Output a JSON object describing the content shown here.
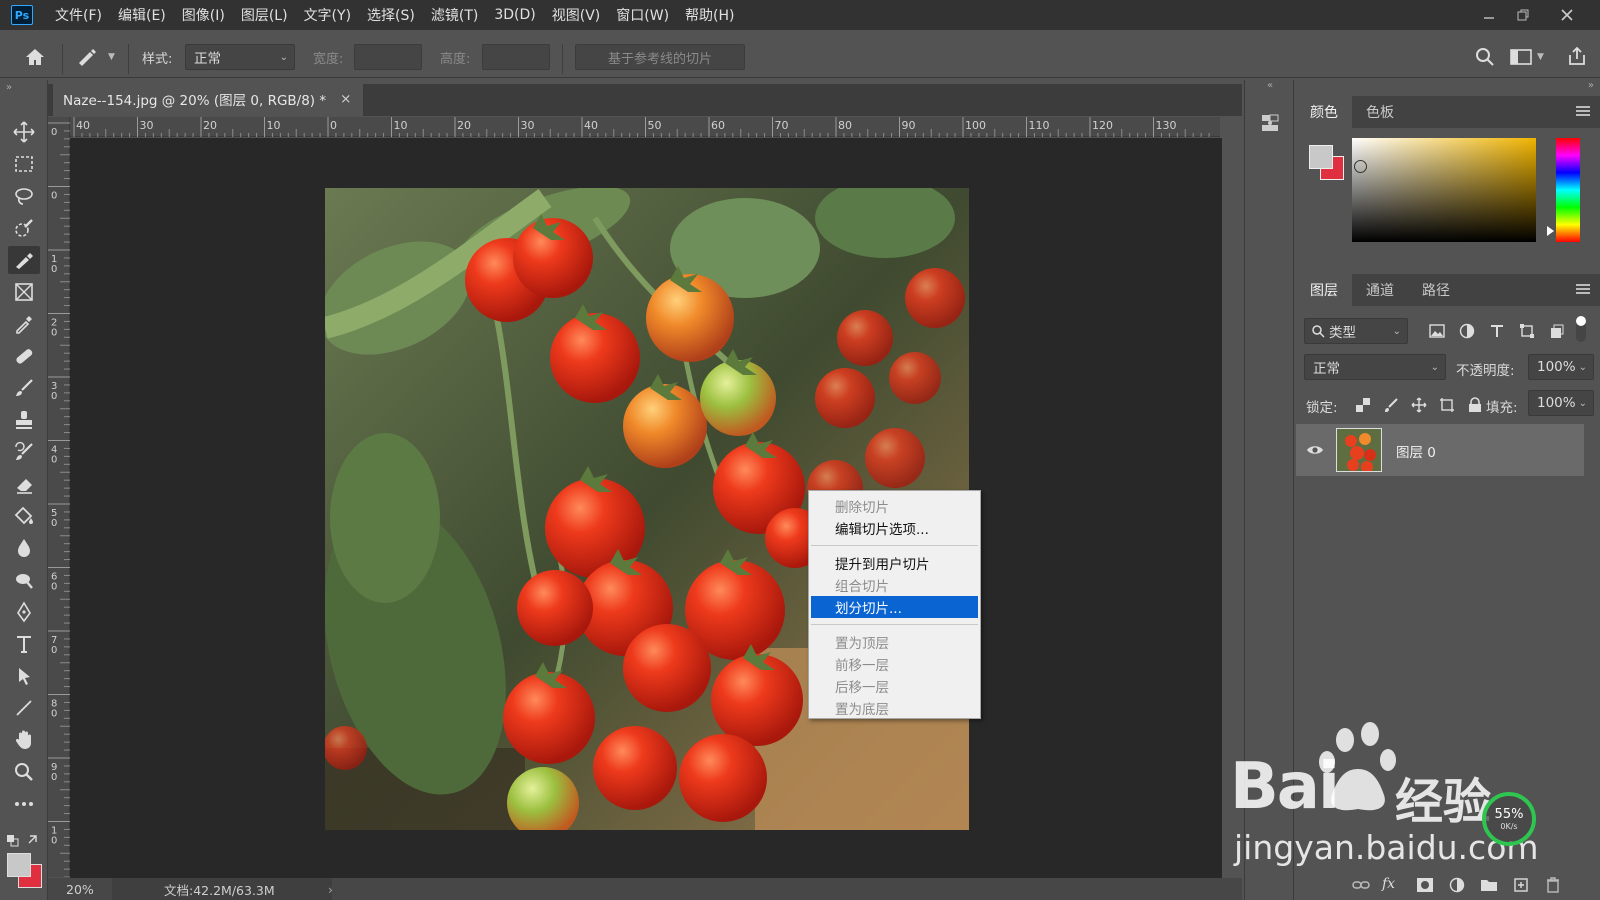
{
  "menubar": {
    "logo": "Ps",
    "items": [
      "文件(F)",
      "编辑(E)",
      "图像(I)",
      "图层(L)",
      "文字(Y)",
      "选择(S)",
      "滤镜(T)",
      "3D(D)",
      "视图(V)",
      "窗口(W)",
      "帮助(H)"
    ]
  },
  "options": {
    "style_label": "样式:",
    "style_value": "正常",
    "width_label": "宽度:",
    "height_label": "高度:",
    "guides_button": "基于参考线的切片"
  },
  "document": {
    "tab_title": "Naze--154.jpg @ 20% (图层 0, RGB/8) *",
    "close": "×",
    "ruler_h": [
      "40",
      "30",
      "20",
      "10",
      "0",
      "10",
      "20",
      "30",
      "40",
      "50",
      "60",
      "70",
      "80",
      "90",
      "100",
      "110",
      "120",
      "130"
    ],
    "ruler_v": [
      "0",
      "0",
      "1 0",
      "2 0",
      "3 0",
      "4 0",
      "5 0",
      "6 0",
      "7 0",
      "8 0",
      "9 0",
      "1 0"
    ],
    "zoom": "20%",
    "doc_info": "文档:42.2M/63.3M",
    "status_arrow": "›"
  },
  "context_menu": {
    "items": [
      {
        "label": "删除切片",
        "enabled": false
      },
      {
        "label": "编辑切片选项...",
        "enabled": true
      },
      {
        "label": "提升到用户切片",
        "enabled": true
      },
      {
        "label": "组合切片",
        "enabled": false
      },
      {
        "label": "划分切片...",
        "enabled": true,
        "highlighted": true
      },
      {
        "label": "置为顶层",
        "enabled": false
      },
      {
        "label": "前移一层",
        "enabled": false
      },
      {
        "label": "后移一层",
        "enabled": false
      },
      {
        "label": "置为底层",
        "enabled": false
      }
    ]
  },
  "color_panel": {
    "tabs": [
      "颜色",
      "色板"
    ],
    "active_tab": "颜色",
    "foreground": "#c8c8c8",
    "background": "#e03040"
  },
  "layers_panel": {
    "tabs": [
      "图层",
      "通道",
      "路径"
    ],
    "active_tab": "图层",
    "filter_label": "类型",
    "blend_mode": "正常",
    "opacity_label": "不透明度:",
    "opacity_value": "100%",
    "lock_label": "锁定:",
    "fill_label": "填充:",
    "fill_value": "100%",
    "layers": [
      {
        "name": "图层 0",
        "visible": true
      }
    ],
    "footer_fx": "fx"
  },
  "watermark": {
    "brand_left": "Bai",
    "brand_right": "经验",
    "url": "jingyan.baidu.com",
    "badge_percent": "55%",
    "badge_speed": "0K/s"
  }
}
